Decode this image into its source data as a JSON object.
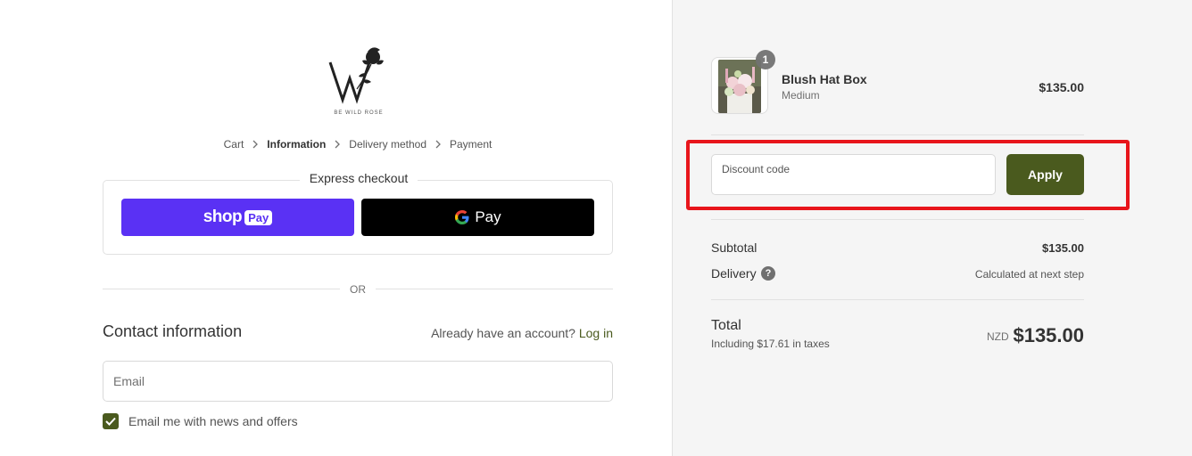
{
  "logo": {
    "icon": "w-rose-logo-icon",
    "caption": "BE WILD ROSE"
  },
  "breadcrumb": {
    "items": [
      "Cart",
      "Information",
      "Delivery method",
      "Payment"
    ],
    "active_index": 1
  },
  "express_checkout": {
    "title": "Express checkout",
    "shop_pay": {
      "word": "shop",
      "badge": "Pay"
    },
    "google_pay": {
      "label": "Pay"
    }
  },
  "divider_or": "OR",
  "contact": {
    "title": "Contact information",
    "account_prompt": "Already have an account?",
    "login_label": "Log in",
    "email_placeholder": "Email",
    "newsletter_label": "Email me with news and offers",
    "newsletter_checked": true
  },
  "order": {
    "product_name": "Blush Hat Box",
    "variant": "Medium",
    "quantity": "1",
    "price": "$135.00"
  },
  "discount": {
    "placeholder": "Discount code",
    "apply_label": "Apply"
  },
  "summary": {
    "subtotal_label": "Subtotal",
    "subtotal_value": "$135.00",
    "delivery_label": "Delivery",
    "delivery_value": "Calculated at next step",
    "help_icon": "?",
    "total_label": "Total",
    "tax_note": "Including $17.61 in taxes",
    "currency": "NZD",
    "total_value": "$135.00"
  },
  "colors": {
    "brand": "#4a5a1e",
    "shop_pay": "#5a31f4",
    "google_pay": "#000000",
    "highlight": "#e8151b"
  }
}
